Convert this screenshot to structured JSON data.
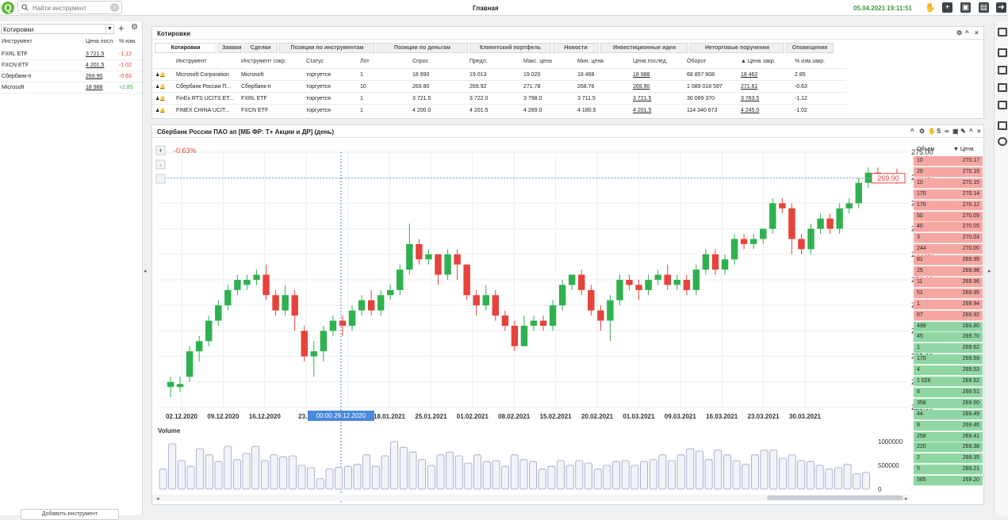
{
  "topbar": {
    "search_placeholder": "Найти инструмент",
    "title": "Главная",
    "clock": "05.04.2021 19:11:51"
  },
  "left_panel": {
    "selected_list": "Котировки",
    "columns": [
      "Инструмент",
      "Цена посл.",
      "% изм."
    ],
    "rows": [
      {
        "name": "FXRL ETF",
        "price": "3 721.5",
        "change": "-1.12",
        "dir": "down"
      },
      {
        "name": "FXCN ETF",
        "price": "4 201.5",
        "change": "-1.02",
        "dir": "down"
      },
      {
        "name": "Сбербанк-п",
        "price": "269.90",
        "change": "-0.63",
        "dir": "down"
      },
      {
        "name": "Microsoft",
        "price": "18 988",
        "change": "+2.85",
        "dir": "up"
      }
    ],
    "add_button": "Добавить инструмент"
  },
  "quotes": {
    "title": "Котировки",
    "tabs": [
      "Котировки",
      "Заявки",
      "Сделки",
      "Позиции по инструментам",
      "Позиции по деньгам",
      "Клиентский портфель",
      "Новости",
      "Инвестиционные идеи",
      "Неторговые поручения",
      "Оповещения"
    ],
    "columns": [
      "Инструмент",
      "Инструмент сокр.",
      "Статус",
      "Лот",
      "Спрос",
      "Предл.",
      "Макс. цена",
      "Мин. цена",
      "Цена послед.",
      "Оборот",
      "▲ Цена закр.",
      "% изм.закр."
    ],
    "rows": [
      [
        "Microsoft Corporation",
        "Microsoft",
        "торгуется",
        "1",
        "18 990",
        "19 013",
        "19 020",
        "18 468",
        "18 988",
        "68 857 608",
        "18 462",
        "2.85"
      ],
      [
        "Сбербанк России П...",
        "Сбербанк-п",
        "торгуется",
        "10",
        "269.80",
        "269.92",
        "271.78",
        "268.76",
        "269.90",
        "1 089 018 597",
        "271.61",
        "-0.63"
      ],
      [
        "FinEx RTS UCITS ET...",
        "FXRL ETF",
        "торгуется",
        "1",
        "3 721.5",
        "3 722.0",
        "3 798.0",
        "3 711.5",
        "3 721.5",
        "30 069 370",
        "3 763.5",
        "-1.12"
      ],
      [
        "FINEX CHINA UCIT...",
        "FXCN ETF",
        "торгуется",
        "1",
        "4 200.0",
        "4 201.5",
        "4 289.0",
        "4 180.5",
        "4 201.5",
        "114 340 673",
        "4 245.0",
        "-1.02"
      ]
    ]
  },
  "chart": {
    "title": "Сбербанк России ПАО ап [МБ ФР: Т+ Акции и ДР] (день)",
    "change_label": "-0.63%",
    "last_price_label": "269.90",
    "crosshair_label": "00:00 29.12.2020",
    "volume_label": "Volume",
    "zoom_in": "+",
    "zoom_out": "-",
    "y_ticks": [
      "275.00",
      "270.00",
      "265.00",
      "260.00",
      "255.00",
      "250.00",
      "245.00",
      "240.00",
      "235.00",
      "230.00",
      "225.00"
    ],
    "x_ticks": [
      "02.12.2020",
      "09.12.2020",
      "16.12.2020",
      "23.12",
      "1.01.2021",
      "18.01.2021",
      "25.01.2021",
      "01.02.2021",
      "08.02.2021",
      "15.02.2021",
      "20.02.2021",
      "01.03.2021",
      "09.03.2021",
      "16.03.2021",
      "23.03.2021",
      "30.03.2021"
    ],
    "vol_ticks": [
      "1000000",
      "500000",
      "0"
    ],
    "colors": {
      "up": "#2fb14f",
      "down": "#e5433b"
    }
  },
  "chart_data": {
    "type": "candlestick",
    "title": "Сбербанк России ПАО ап [МБ ФР: Т+ Акции и ДР] (день)",
    "ylim": [
      225,
      275
    ],
    "x": [
      "02.12.2020",
      "09.12.2020",
      "16.12.2020",
      "23.12",
      "1.01.2021",
      "18.01.2021",
      "25.01.2021",
      "01.02.2021",
      "08.02.2021",
      "15.02.2021",
      "20.02.2021",
      "01.03.2021",
      "09.03.2021",
      "16.03.2021",
      "23.03.2021",
      "30.03.2021"
    ],
    "candles": [
      [
        229,
        230,
        227,
        231
      ],
      [
        229,
        229.6,
        228,
        231
      ],
      [
        231,
        236,
        230,
        237
      ],
      [
        236,
        238,
        234,
        239
      ],
      [
        238,
        242,
        237,
        243
      ],
      [
        242,
        245,
        241,
        246
      ],
      [
        245,
        248,
        244,
        249
      ],
      [
        248,
        250,
        247,
        251
      ],
      [
        249,
        250,
        248,
        251
      ],
      [
        250,
        251,
        249,
        252
      ],
      [
        251,
        247,
        246,
        253
      ],
      [
        247,
        244,
        243,
        248
      ],
      [
        244,
        247,
        243,
        249
      ],
      [
        247,
        243,
        240,
        248
      ],
      [
        240,
        235,
        234,
        241
      ],
      [
        235,
        236,
        231,
        238
      ],
      [
        236,
        240,
        234,
        241
      ],
      [
        240,
        242,
        239,
        243
      ],
      [
        242,
        241,
        239,
        243
      ],
      [
        241,
        244,
        240,
        245
      ],
      [
        244,
        246,
        243,
        247
      ],
      [
        246,
        244,
        243,
        248
      ],
      [
        244,
        247,
        243,
        248
      ],
      [
        247,
        248,
        246,
        249
      ],
      [
        248,
        252,
        247,
        253
      ],
      [
        252,
        257,
        251,
        261
      ],
      [
        257,
        254,
        253,
        258
      ],
      [
        254,
        255,
        253,
        256
      ],
      [
        255,
        251,
        249,
        255
      ],
      [
        251,
        255,
        250,
        256
      ],
      [
        255,
        253,
        250,
        256
      ],
      [
        253,
        247,
        246,
        253
      ],
      [
        247,
        245,
        243,
        248
      ],
      [
        245,
        247,
        244,
        249
      ],
      [
        247,
        243,
        242,
        248
      ],
      [
        243,
        241,
        240,
        244
      ],
      [
        241,
        237,
        236,
        242
      ],
      [
        237,
        241,
        237,
        243
      ],
      [
        241,
        242,
        240,
        243
      ],
      [
        242,
        241,
        240,
        243
      ],
      [
        241,
        245,
        240,
        246
      ],
      [
        245,
        249,
        244,
        250
      ],
      [
        249,
        251,
        248,
        251
      ],
      [
        251,
        248,
        247,
        252
      ],
      [
        248,
        244,
        243,
        249
      ],
      [
        244,
        242,
        240,
        245
      ],
      [
        242,
        246,
        238,
        247
      ],
      [
        246,
        250,
        245,
        251
      ],
      [
        250,
        249,
        248,
        251
      ],
      [
        249,
        248,
        246,
        250
      ],
      [
        248,
        250,
        247,
        251
      ],
      [
        250,
        251,
        249,
        252
      ],
      [
        251,
        249,
        248,
        253
      ],
      [
        249,
        250,
        248,
        251
      ],
      [
        250,
        248,
        247,
        251
      ],
      [
        248,
        252,
        247,
        253
      ],
      [
        252,
        255,
        251,
        256
      ],
      [
        255,
        252,
        251,
        256
      ],
      [
        252,
        254,
        251,
        255
      ],
      [
        254,
        258,
        253,
        259
      ],
      [
        258,
        257,
        256,
        259
      ],
      [
        257,
        258,
        256,
        259
      ],
      [
        258,
        260,
        257,
        260
      ],
      [
        260,
        265,
        259,
        266
      ],
      [
        265,
        264,
        263,
        266
      ],
      [
        264,
        258,
        255,
        265
      ],
      [
        258,
        256,
        255,
        259
      ],
      [
        256,
        260,
        255,
        261
      ],
      [
        260,
        262,
        259,
        263
      ],
      [
        262,
        260,
        259,
        263
      ],
      [
        260,
        264,
        259,
        265
      ],
      [
        264,
        265,
        263,
        266
      ],
      [
        265,
        269,
        264,
        270
      ],
      [
        269,
        271,
        268,
        272
      ],
      [
        271,
        270,
        269,
        272
      ],
      [
        270,
        270.5,
        269,
        271
      ],
      [
        270.5,
        269.9,
        268.8,
        271.8
      ]
    ],
    "volume": [
      0.42,
      0.95,
      0.6,
      0.48,
      0.85,
      0.72,
      0.58,
      0.9,
      0.62,
      0.75,
      0.9,
      0.6,
      0.72,
      0.68,
      0.7,
      0.5,
      0.45,
      0.22,
      0.42,
      0.46,
      0.48,
      0.52,
      0.72,
      0.48,
      0.7,
      1.0,
      0.88,
      0.78,
      0.62,
      0.5,
      0.72,
      0.78,
      0.7,
      0.55,
      0.72,
      0.58,
      0.6,
      0.48,
      0.72,
      0.62,
      0.58,
      0.42,
      0.48,
      0.6,
      0.5,
      0.6,
      0.55,
      0.42,
      0.5,
      0.58,
      0.6,
      0.5,
      0.58,
      0.62,
      0.72,
      0.6,
      0.72,
      0.85,
      0.8,
      0.62,
      0.82,
      0.72,
      0.6,
      0.52,
      0.72,
      0.82,
      0.82,
      0.65,
      0.72,
      0.6,
      0.58,
      0.5,
      0.42,
      0.45,
      0.52,
      0.32,
      0.35
    ],
    "orderbook": {
      "columns": [
        "Объем",
        "▼ Цена"
      ],
      "asks": [
        [
          "10",
          "270.17"
        ],
        [
          "20",
          "270.16"
        ],
        [
          "10",
          "270.15"
        ],
        [
          "170",
          "270.14"
        ],
        [
          "170",
          "270.12"
        ],
        [
          "50",
          "270.09"
        ],
        [
          "40",
          "270.05"
        ],
        [
          "3",
          "270.03"
        ],
        [
          "244",
          "270.00"
        ],
        [
          "81",
          "269.99"
        ],
        [
          "25",
          "269.98"
        ],
        [
          "11",
          "269.96"
        ],
        [
          "51",
          "269.95"
        ],
        [
          "1",
          "269.94"
        ],
        [
          "87",
          "269.92"
        ]
      ],
      "bids": [
        [
          "498",
          "269.80"
        ],
        [
          "45",
          "269.70"
        ],
        [
          "1",
          "269.62"
        ],
        [
          "170",
          "269.59"
        ],
        [
          "4",
          "269.53"
        ],
        [
          "1 026",
          "269.52"
        ],
        [
          "6",
          "269.51"
        ],
        [
          "358",
          "269.50"
        ],
        [
          "44",
          "269.49"
        ],
        [
          "8",
          "269.46"
        ],
        [
          "258",
          "269.41"
        ],
        [
          "220",
          "269.38"
        ],
        [
          "2",
          "269.35"
        ],
        [
          "5",
          "269.21"
        ],
        [
          "565",
          "269.20"
        ]
      ]
    }
  }
}
